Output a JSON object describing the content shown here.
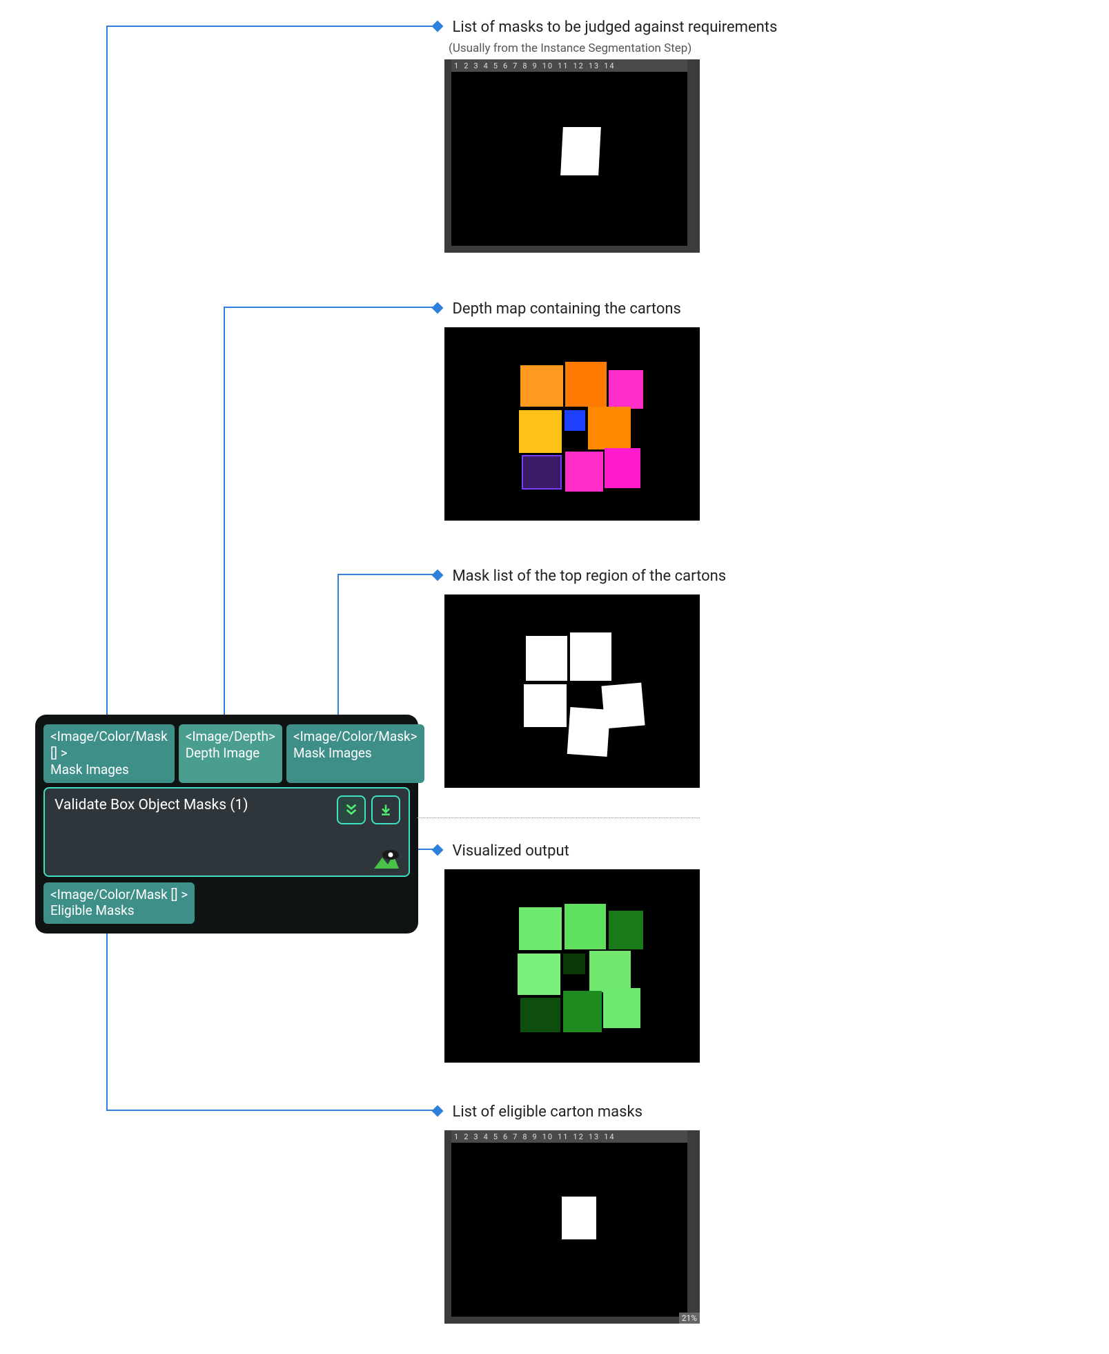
{
  "colors": {
    "accent": "#2f7fdc",
    "nodeTeal": "#3f8f89",
    "highlight": "#3de2c3"
  },
  "node": {
    "title": "Validate Box Object Masks (1)",
    "inputs": [
      {
        "type": "<Image/Color/Mask [] >",
        "label": "Mask Images"
      },
      {
        "type": "<Image/Depth>",
        "label": "Depth Image"
      },
      {
        "type": "<Image/Color/Mask>",
        "label": "Mask Images"
      }
    ],
    "output": {
      "type": "<Image/Color/Mask [] >",
      "label": "Eligible Masks"
    }
  },
  "annotations": {
    "masksIn": {
      "title": "List of masks to be judged against requirements",
      "subtitle": "(Usually from the Instance Segmentation Step)"
    },
    "depth": {
      "title": "Depth map containing the cartons"
    },
    "topMasks": {
      "title": "Mask list of the top region of the cartons"
    },
    "viz": {
      "title": "Visualized output"
    },
    "eligible": {
      "title": "List of eligible carton masks"
    }
  },
  "thumbnails": {
    "tabs": [
      "1",
      "2",
      "3",
      "4",
      "5",
      "6",
      "7",
      "8",
      "9",
      "10",
      "11",
      "12",
      "13",
      "14"
    ],
    "zoomLabel": "21%"
  }
}
